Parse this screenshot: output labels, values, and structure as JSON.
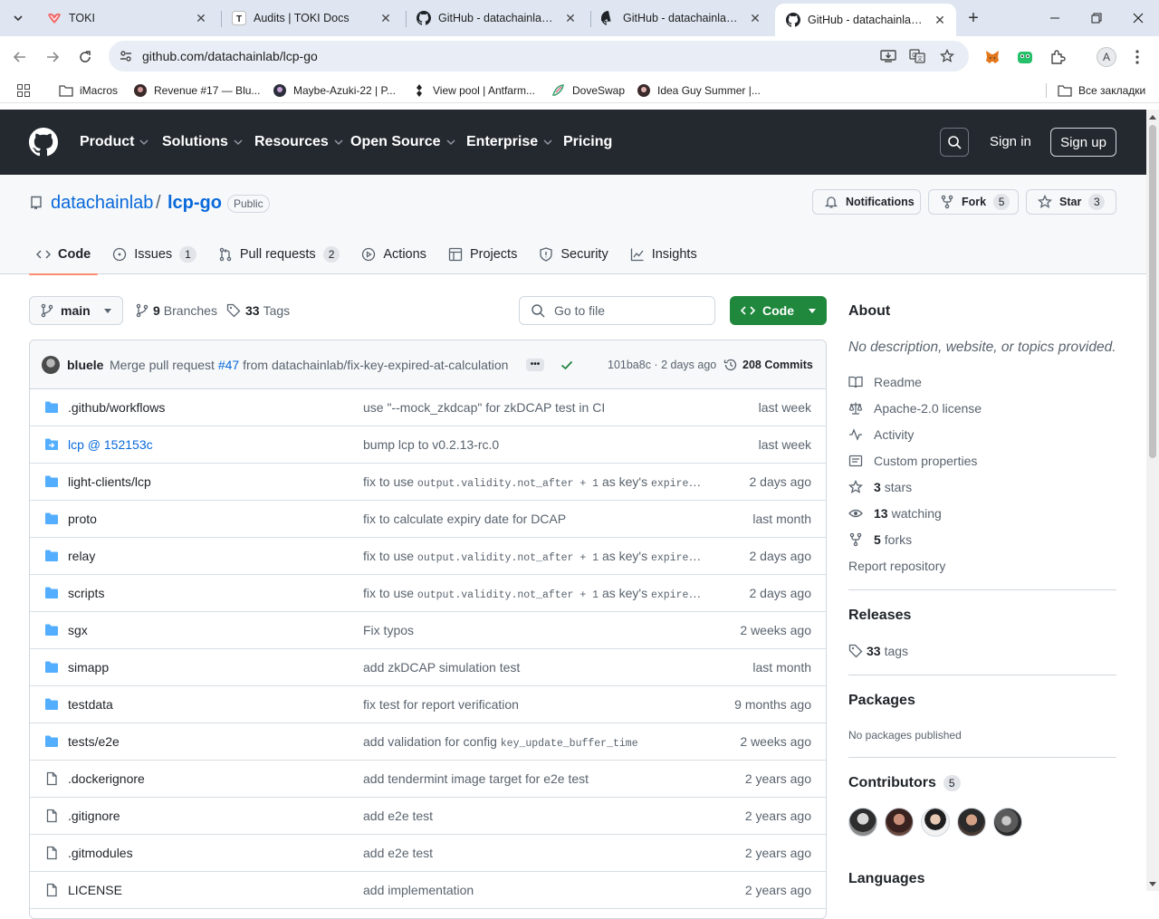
{
  "browser": {
    "tabs": [
      {
        "title": "TOKI",
        "favicon": "toki-icon",
        "active": false
      },
      {
        "title": "Audits | TOKI Docs",
        "favicon": "toki-docs-icon",
        "active": false
      },
      {
        "title": "GitHub - datachainlab/cosmos-ethereum-ibc-lcp",
        "favicon": "github-icon",
        "active": false
      },
      {
        "title": "GitHub - datachainlab/ibc-solidity",
        "favicon": "github-icon",
        "active": false
      },
      {
        "title": "GitHub - datachainlab/lcp-go",
        "favicon": "github-icon",
        "active": true
      }
    ],
    "url": "github.com/datachainlab/lcp-go",
    "profile_initial": "A",
    "bookmarks": [
      {
        "label": "iMacros",
        "icon": "folder-icon"
      },
      {
        "label": "Revenue #17 — Blu...",
        "icon": "site-icon"
      },
      {
        "label": "Maybe-Azuki-22 | P...",
        "icon": "site-icon"
      },
      {
        "label": "View pool | Antfarm...",
        "icon": "site-icon"
      },
      {
        "label": "DoveSwap",
        "icon": "site-icon"
      },
      {
        "label": "Idea Guy Summer |...",
        "icon": "site-icon"
      }
    ],
    "all_bookmarks": "Все закладки"
  },
  "gh": {
    "nav": [
      "Product",
      "Solutions",
      "Resources",
      "Open Source",
      "Enterprise",
      "Pricing"
    ],
    "sign_in": "Sign in",
    "sign_up": "Sign up"
  },
  "repo": {
    "owner": "datachainlab",
    "slash": "/",
    "name": "lcp-go",
    "visibility": "Public",
    "notifications": "Notifications",
    "fork_label": "Fork",
    "fork_count": "5",
    "star_label": "Star",
    "star_count": "3",
    "tabs": [
      {
        "label": "Code",
        "count": null
      },
      {
        "label": "Issues",
        "count": "1"
      },
      {
        "label": "Pull requests",
        "count": "2"
      },
      {
        "label": "Actions",
        "count": null
      },
      {
        "label": "Projects",
        "count": null
      },
      {
        "label": "Security",
        "count": null
      },
      {
        "label": "Insights",
        "count": null
      }
    ]
  },
  "toolbar": {
    "branch": "main",
    "branches_count": "9",
    "branches_label": "Branches",
    "tags_count": "33",
    "tags_label": "Tags",
    "go_to_file": "Go to file",
    "code_button": "Code"
  },
  "commit": {
    "author": "bluele",
    "message_prefix": "Merge pull request ",
    "pr": "#47",
    "message_suffix": " from datachainlab/fix-key-expired-at-calculation",
    "sha_time": "101ba8c · 2 days ago",
    "commits": "208 Commits"
  },
  "files": [
    {
      "type": "dir",
      "name": ".github/workflows",
      "msg": "use \"--mock_zkdcap\" for zkDCAP test in CI",
      "time": "last week"
    },
    {
      "type": "submodule",
      "name": "lcp @ 152153c",
      "msg": "bump lcp to v0.2.13-rc.0",
      "time": "last week"
    },
    {
      "type": "dir",
      "name": "light-clients/lcp",
      "msg_parts": [
        "fix to use ",
        "output.validity.not_after + 1",
        " as key's ",
        "expiredA…"
      ],
      "time": "2 days ago"
    },
    {
      "type": "dir",
      "name": "proto",
      "msg": "fix to calculate expiry date for DCAP",
      "time": "last month"
    },
    {
      "type": "dir",
      "name": "relay",
      "msg_parts": [
        "fix to use ",
        "output.validity.not_after + 1",
        " as key's ",
        "expiredA…"
      ],
      "time": "2 days ago"
    },
    {
      "type": "dir",
      "name": "scripts",
      "msg_parts": [
        "fix to use ",
        "output.validity.not_after + 1",
        " as key's ",
        "expiredA…"
      ],
      "time": "2 days ago"
    },
    {
      "type": "dir",
      "name": "sgx",
      "msg": "Fix typos",
      "time": "2 weeks ago"
    },
    {
      "type": "dir",
      "name": "simapp",
      "msg": "add zkDCAP simulation test",
      "time": "last month"
    },
    {
      "type": "dir",
      "name": "testdata",
      "msg": "fix test for report verification",
      "time": "9 months ago"
    },
    {
      "type": "dir",
      "name": "tests/e2e",
      "msg_parts": [
        "add validation for config ",
        "key_update_buffer_time",
        "",
        ""
      ],
      "time": "2 weeks ago"
    },
    {
      "type": "file",
      "name": ".dockerignore",
      "msg": "add tendermint image target for e2e test",
      "time": "2 years ago"
    },
    {
      "type": "file",
      "name": ".gitignore",
      "msg": "add e2e test",
      "time": "2 years ago"
    },
    {
      "type": "file",
      "name": ".gitmodules",
      "msg": "add e2e test",
      "time": "2 years ago"
    },
    {
      "type": "file",
      "name": "LICENSE",
      "msg": "add implementation",
      "time": "2 years ago"
    }
  ],
  "about": {
    "title": "About",
    "description": "No description, website, or topics provided.",
    "items": [
      {
        "icon": "book-icon",
        "bold": "",
        "text": "Readme"
      },
      {
        "icon": "law-icon",
        "bold": "",
        "text": "Apache-2.0 license"
      },
      {
        "icon": "pulse-icon",
        "bold": "",
        "text": "Activity"
      },
      {
        "icon": "note-icon",
        "bold": "",
        "text": "Custom properties"
      },
      {
        "icon": "star-icon",
        "bold": "3",
        "text": "stars"
      },
      {
        "icon": "eye-icon",
        "bold": "13",
        "text": "watching"
      },
      {
        "icon": "fork-icon",
        "bold": "5",
        "text": "forks"
      }
    ],
    "report": "Report repository"
  },
  "releases": {
    "title": "Releases",
    "tags_count": "33",
    "tags_label": "tags"
  },
  "packages": {
    "title": "Packages",
    "empty": "No packages published"
  },
  "contributors": {
    "title": "Contributors",
    "count": "5"
  },
  "languages": {
    "title": "Languages"
  }
}
